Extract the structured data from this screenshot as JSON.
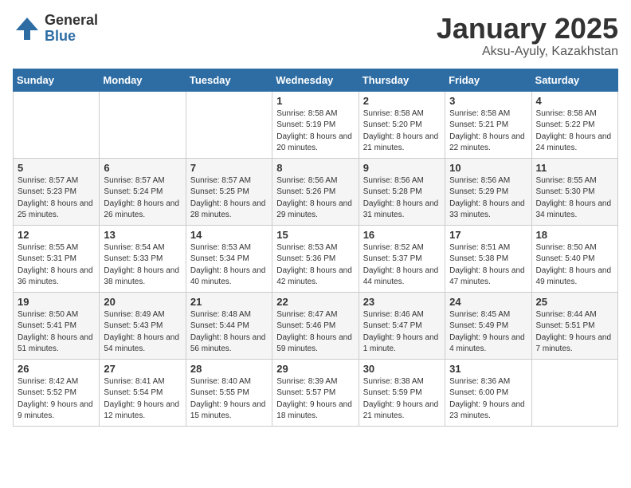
{
  "logo": {
    "general": "General",
    "blue": "Blue"
  },
  "title": "January 2025",
  "subtitle": "Aksu-Ayuly, Kazakhstan",
  "weekdays": [
    "Sunday",
    "Monday",
    "Tuesday",
    "Wednesday",
    "Thursday",
    "Friday",
    "Saturday"
  ],
  "weeks": [
    [
      {
        "day": "",
        "sunrise": "",
        "sunset": "",
        "daylight": ""
      },
      {
        "day": "",
        "sunrise": "",
        "sunset": "",
        "daylight": ""
      },
      {
        "day": "",
        "sunrise": "",
        "sunset": "",
        "daylight": ""
      },
      {
        "day": "1",
        "sunrise": "Sunrise: 8:58 AM",
        "sunset": "Sunset: 5:19 PM",
        "daylight": "Daylight: 8 hours and 20 minutes."
      },
      {
        "day": "2",
        "sunrise": "Sunrise: 8:58 AM",
        "sunset": "Sunset: 5:20 PM",
        "daylight": "Daylight: 8 hours and 21 minutes."
      },
      {
        "day": "3",
        "sunrise": "Sunrise: 8:58 AM",
        "sunset": "Sunset: 5:21 PM",
        "daylight": "Daylight: 8 hours and 22 minutes."
      },
      {
        "day": "4",
        "sunrise": "Sunrise: 8:58 AM",
        "sunset": "Sunset: 5:22 PM",
        "daylight": "Daylight: 8 hours and 24 minutes."
      }
    ],
    [
      {
        "day": "5",
        "sunrise": "Sunrise: 8:57 AM",
        "sunset": "Sunset: 5:23 PM",
        "daylight": "Daylight: 8 hours and 25 minutes."
      },
      {
        "day": "6",
        "sunrise": "Sunrise: 8:57 AM",
        "sunset": "Sunset: 5:24 PM",
        "daylight": "Daylight: 8 hours and 26 minutes."
      },
      {
        "day": "7",
        "sunrise": "Sunrise: 8:57 AM",
        "sunset": "Sunset: 5:25 PM",
        "daylight": "Daylight: 8 hours and 28 minutes."
      },
      {
        "day": "8",
        "sunrise": "Sunrise: 8:56 AM",
        "sunset": "Sunset: 5:26 PM",
        "daylight": "Daylight: 8 hours and 29 minutes."
      },
      {
        "day": "9",
        "sunrise": "Sunrise: 8:56 AM",
        "sunset": "Sunset: 5:28 PM",
        "daylight": "Daylight: 8 hours and 31 minutes."
      },
      {
        "day": "10",
        "sunrise": "Sunrise: 8:56 AM",
        "sunset": "Sunset: 5:29 PM",
        "daylight": "Daylight: 8 hours and 33 minutes."
      },
      {
        "day": "11",
        "sunrise": "Sunrise: 8:55 AM",
        "sunset": "Sunset: 5:30 PM",
        "daylight": "Daylight: 8 hours and 34 minutes."
      }
    ],
    [
      {
        "day": "12",
        "sunrise": "Sunrise: 8:55 AM",
        "sunset": "Sunset: 5:31 PM",
        "daylight": "Daylight: 8 hours and 36 minutes."
      },
      {
        "day": "13",
        "sunrise": "Sunrise: 8:54 AM",
        "sunset": "Sunset: 5:33 PM",
        "daylight": "Daylight: 8 hours and 38 minutes."
      },
      {
        "day": "14",
        "sunrise": "Sunrise: 8:53 AM",
        "sunset": "Sunset: 5:34 PM",
        "daylight": "Daylight: 8 hours and 40 minutes."
      },
      {
        "day": "15",
        "sunrise": "Sunrise: 8:53 AM",
        "sunset": "Sunset: 5:36 PM",
        "daylight": "Daylight: 8 hours and 42 minutes."
      },
      {
        "day": "16",
        "sunrise": "Sunrise: 8:52 AM",
        "sunset": "Sunset: 5:37 PM",
        "daylight": "Daylight: 8 hours and 44 minutes."
      },
      {
        "day": "17",
        "sunrise": "Sunrise: 8:51 AM",
        "sunset": "Sunset: 5:38 PM",
        "daylight": "Daylight: 8 hours and 47 minutes."
      },
      {
        "day": "18",
        "sunrise": "Sunrise: 8:50 AM",
        "sunset": "Sunset: 5:40 PM",
        "daylight": "Daylight: 8 hours and 49 minutes."
      }
    ],
    [
      {
        "day": "19",
        "sunrise": "Sunrise: 8:50 AM",
        "sunset": "Sunset: 5:41 PM",
        "daylight": "Daylight: 8 hours and 51 minutes."
      },
      {
        "day": "20",
        "sunrise": "Sunrise: 8:49 AM",
        "sunset": "Sunset: 5:43 PM",
        "daylight": "Daylight: 8 hours and 54 minutes."
      },
      {
        "day": "21",
        "sunrise": "Sunrise: 8:48 AM",
        "sunset": "Sunset: 5:44 PM",
        "daylight": "Daylight: 8 hours and 56 minutes."
      },
      {
        "day": "22",
        "sunrise": "Sunrise: 8:47 AM",
        "sunset": "Sunset: 5:46 PM",
        "daylight": "Daylight: 8 hours and 59 minutes."
      },
      {
        "day": "23",
        "sunrise": "Sunrise: 8:46 AM",
        "sunset": "Sunset: 5:47 PM",
        "daylight": "Daylight: 9 hours and 1 minute."
      },
      {
        "day": "24",
        "sunrise": "Sunrise: 8:45 AM",
        "sunset": "Sunset: 5:49 PM",
        "daylight": "Daylight: 9 hours and 4 minutes."
      },
      {
        "day": "25",
        "sunrise": "Sunrise: 8:44 AM",
        "sunset": "Sunset: 5:51 PM",
        "daylight": "Daylight: 9 hours and 7 minutes."
      }
    ],
    [
      {
        "day": "26",
        "sunrise": "Sunrise: 8:42 AM",
        "sunset": "Sunset: 5:52 PM",
        "daylight": "Daylight: 9 hours and 9 minutes."
      },
      {
        "day": "27",
        "sunrise": "Sunrise: 8:41 AM",
        "sunset": "Sunset: 5:54 PM",
        "daylight": "Daylight: 9 hours and 12 minutes."
      },
      {
        "day": "28",
        "sunrise": "Sunrise: 8:40 AM",
        "sunset": "Sunset: 5:55 PM",
        "daylight": "Daylight: 9 hours and 15 minutes."
      },
      {
        "day": "29",
        "sunrise": "Sunrise: 8:39 AM",
        "sunset": "Sunset: 5:57 PM",
        "daylight": "Daylight: 9 hours and 18 minutes."
      },
      {
        "day": "30",
        "sunrise": "Sunrise: 8:38 AM",
        "sunset": "Sunset: 5:59 PM",
        "daylight": "Daylight: 9 hours and 21 minutes."
      },
      {
        "day": "31",
        "sunrise": "Sunrise: 8:36 AM",
        "sunset": "Sunset: 6:00 PM",
        "daylight": "Daylight: 9 hours and 23 minutes."
      },
      {
        "day": "",
        "sunrise": "",
        "sunset": "",
        "daylight": ""
      }
    ]
  ]
}
